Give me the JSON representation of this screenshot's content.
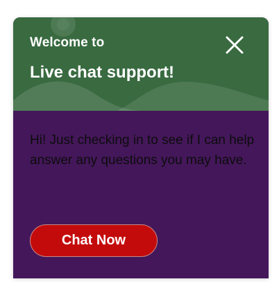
{
  "widget": {
    "welcome_text": "Welcome to",
    "title": "Live chat support!",
    "close_icon": "close-icon",
    "message": "Hi! Just checking in to see if I can help answer any questions you may have.",
    "chat_button_label": "Chat Now"
  },
  "colors": {
    "header_background": "#396a40",
    "body_background": "#44175a",
    "button_background": "#c40b0c",
    "text_light": "#ffffff",
    "message_text": "#0d0d0d"
  }
}
